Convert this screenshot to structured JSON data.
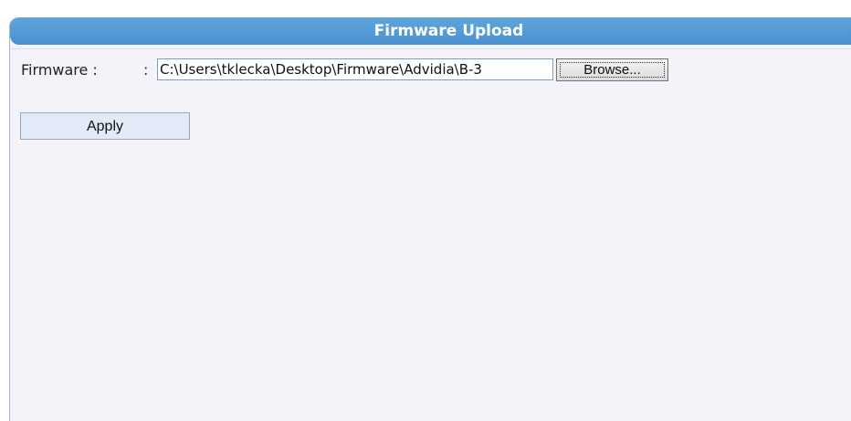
{
  "window": {
    "title": "Firmware Upload"
  },
  "form": {
    "firmware_label": "Firmware :",
    "colon": ":",
    "file_path": "C:\\Users\\tklecka\\Desktop\\Firmware\\Advidia\\B-3",
    "browse_label": "Browse...",
    "apply_label": "Apply"
  },
  "colors": {
    "titlebar": "#4a90cf",
    "panel_background": "#f4f3fa",
    "apply_button": "#e2e9f7"
  }
}
